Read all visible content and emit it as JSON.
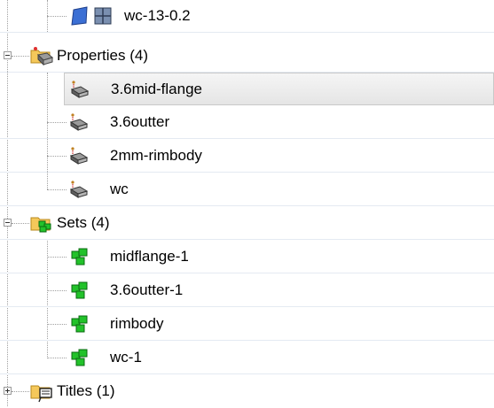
{
  "tree": {
    "component_row": {
      "label": "wc-13-0.2"
    },
    "properties": {
      "label": "Properties (4)",
      "items": [
        {
          "label": "3.6mid-flange",
          "selected": true
        },
        {
          "label": "3.6outter"
        },
        {
          "label": "2mm-rimbody"
        },
        {
          "label": "wc"
        }
      ]
    },
    "sets": {
      "label": "Sets (4)",
      "items": [
        {
          "label": "midflange-1"
        },
        {
          "label": "3.6outter-1"
        },
        {
          "label": "rimbody"
        },
        {
          "label": "wc-1"
        }
      ]
    },
    "titles": {
      "label": "Titles (1)"
    }
  },
  "colors": {
    "set_icon_green": "#22c22a",
    "folder_yellow": "#f5c85a",
    "component_blue": "#3b6fd4",
    "row_divider": "#e4eaf2"
  }
}
